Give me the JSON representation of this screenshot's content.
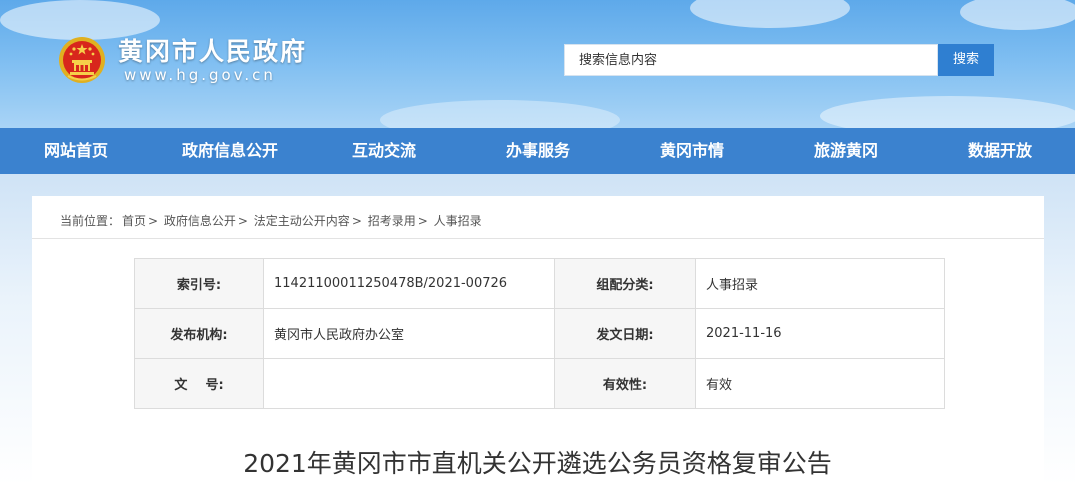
{
  "header": {
    "site_name": "黄冈市人民政府",
    "site_url": "www.hg.gov.cn",
    "search_placeholder": "搜索信息内容",
    "search_button": "搜索"
  },
  "nav": {
    "items": [
      {
        "label": "网站首页"
      },
      {
        "label": "政府信息公开"
      },
      {
        "label": "互动交流"
      },
      {
        "label": "办事服务"
      },
      {
        "label": "黄冈市情"
      },
      {
        "label": "旅游黄冈"
      },
      {
        "label": "数据开放"
      }
    ]
  },
  "breadcrumb": {
    "prefix": "当前位置：",
    "items": [
      "首页",
      "政府信息公开",
      "法定主动公开内容",
      "招考录用",
      "人事招录"
    ],
    "separator": "> "
  },
  "meta": {
    "index_label": "索引号:",
    "index_value": "11421100011250478B/2021-00726",
    "category_label": "组配分类:",
    "category_value": "人事招录",
    "publisher_label": "发布机构:",
    "publisher_value": "黄冈市人民政府办公室",
    "date_label": "发文日期:",
    "date_value": "2021-11-16",
    "docno_label": "文    号:",
    "docno_value": "",
    "validity_label": "有效性:",
    "validity_value": "有效"
  },
  "article": {
    "title": "2021年黄冈市市直机关公开遴选公务员资格复审公告"
  },
  "colors": {
    "nav_bg": "#3b82cf",
    "search_btn": "#2f7fd1"
  }
}
